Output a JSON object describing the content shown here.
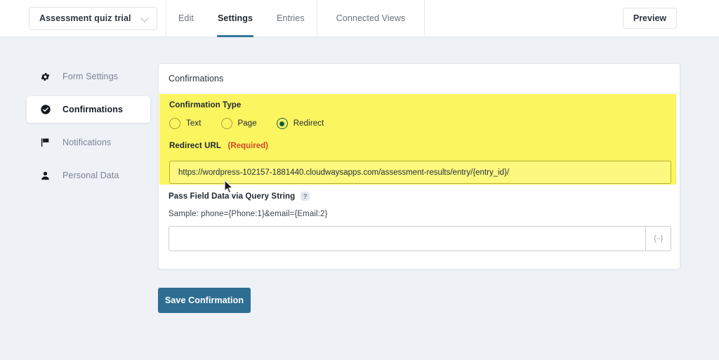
{
  "topbar": {
    "form_selector": {
      "label": "Assessment quiz trial",
      "icon": "chevron-down-icon"
    },
    "tabs": [
      {
        "label": "Edit",
        "active": false
      },
      {
        "label": "Settings",
        "active": true
      },
      {
        "label": "Entries",
        "active": false
      },
      {
        "label": "Connected Views",
        "active": false
      }
    ],
    "preview_label": "Preview"
  },
  "sidebar": {
    "items": [
      {
        "label": "Form Settings",
        "icon": "gear-icon",
        "active": false
      },
      {
        "label": "Confirmations",
        "icon": "check-circle-icon",
        "active": true
      },
      {
        "label": "Notifications",
        "icon": "flag-icon",
        "active": false
      },
      {
        "label": "Personal Data",
        "icon": "user-icon",
        "active": false
      }
    ]
  },
  "card": {
    "title": "Confirmations",
    "confirmation_type": {
      "label": "Confirmation Type",
      "options": [
        {
          "label": "Text",
          "selected": false
        },
        {
          "label": "Page",
          "selected": false
        },
        {
          "label": "Redirect",
          "selected": true
        }
      ]
    },
    "redirect_url": {
      "label": "Redirect URL",
      "required_text": "(Required)",
      "value": "https://wordpress-102157-1881440.cloudwaysapps.com/assessment-results/entry/{entry_id}/",
      "placeholder": ""
    },
    "query_string": {
      "label": "Pass Field Data via Query String",
      "help_icon": "help-question-icon",
      "help_glyph": "?",
      "sample": "Sample: phone={Phone:1}&email={Email:2}",
      "value": "",
      "placeholder": "",
      "merge_tag_glyph": "{··}",
      "merge_tag_icon": "merge-tag-icon"
    }
  },
  "actions": {
    "save_label": "Save Confirmation"
  },
  "colors": {
    "accent": "#2f6e93",
    "highlight": "#fbf55f",
    "required": "#d2492a",
    "radio_selected": "#0f5c42",
    "page_background": "#eef1f6"
  }
}
